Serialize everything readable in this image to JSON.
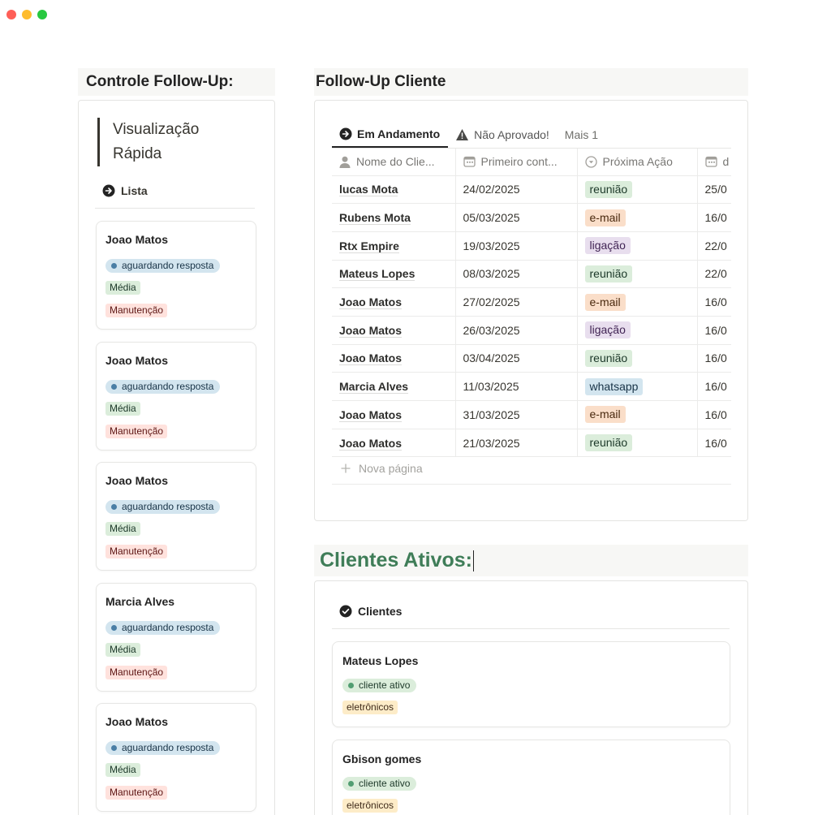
{
  "left": {
    "heading": "Controle Follow-Up:",
    "quote": "Visualização Rápida",
    "tab_label": "Lista",
    "cards": [
      {
        "name": "Joao Matos",
        "status": "aguardando resposta",
        "priority": "Média",
        "category": "Manutenção"
      },
      {
        "name": "Joao Matos",
        "status": "aguardando resposta",
        "priority": "Média",
        "category": "Manutenção"
      },
      {
        "name": "Joao Matos",
        "status": "aguardando resposta",
        "priority": "Média",
        "category": "Manutenção"
      },
      {
        "name": "Marcia Alves",
        "status": "aguardando resposta",
        "priority": "Média",
        "category": "Manutenção"
      },
      {
        "name": "Joao Matos",
        "status": "aguardando resposta",
        "priority": "Média",
        "category": "Manutenção"
      }
    ]
  },
  "followup": {
    "heading": "Follow-Up Cliente",
    "tabs": [
      "Em Andamento",
      "Não Aprovado!",
      "Mais 1"
    ],
    "columns": [
      "Nome do Clie...",
      "Primeiro cont...",
      "Próxima Ação",
      "d"
    ],
    "rows": [
      {
        "name": "lucas Mota",
        "first": "24/02/2025",
        "action": "reunião",
        "action_type": "reuniao",
        "date": "25/0"
      },
      {
        "name": "Rubens Mota",
        "first": "05/03/2025",
        "action": "e-mail",
        "action_type": "email",
        "date": "16/0"
      },
      {
        "name": "Rtx Empire",
        "first": "19/03/2025",
        "action": "ligação",
        "action_type": "ligacao",
        "date": "22/0"
      },
      {
        "name": "Mateus Lopes",
        "first": "08/03/2025",
        "action": "reunião",
        "action_type": "reuniao",
        "date": "22/0"
      },
      {
        "name": "Joao Matos",
        "first": "27/02/2025",
        "action": "e-mail",
        "action_type": "email",
        "date": "16/0"
      },
      {
        "name": "Joao Matos",
        "first": "26/03/2025",
        "action": "ligação",
        "action_type": "ligacao",
        "date": "16/0"
      },
      {
        "name": "Joao Matos",
        "first": "03/04/2025",
        "action": "reunião",
        "action_type": "reuniao",
        "date": "16/0"
      },
      {
        "name": "Marcia Alves",
        "first": "11/03/2025",
        "action": "whatsapp",
        "action_type": "whatsapp",
        "date": "16/0"
      },
      {
        "name": "Joao Matos",
        "first": "31/03/2025",
        "action": "e-mail",
        "action_type": "email",
        "date": "16/0"
      },
      {
        "name": "Joao Matos",
        "first": "21/03/2025",
        "action": "reunião",
        "action_type": "reuniao",
        "date": "16/0"
      }
    ],
    "new_page": "Nova página"
  },
  "clientes": {
    "heading": "Clientes Ativos:",
    "tab_label": "Clientes",
    "cards": [
      {
        "name": "Mateus Lopes",
        "status": "cliente ativo",
        "category": "eletrônicos"
      },
      {
        "name": "Gbison gomes",
        "status": "cliente ativo",
        "category": "eletrônicos"
      }
    ]
  }
}
